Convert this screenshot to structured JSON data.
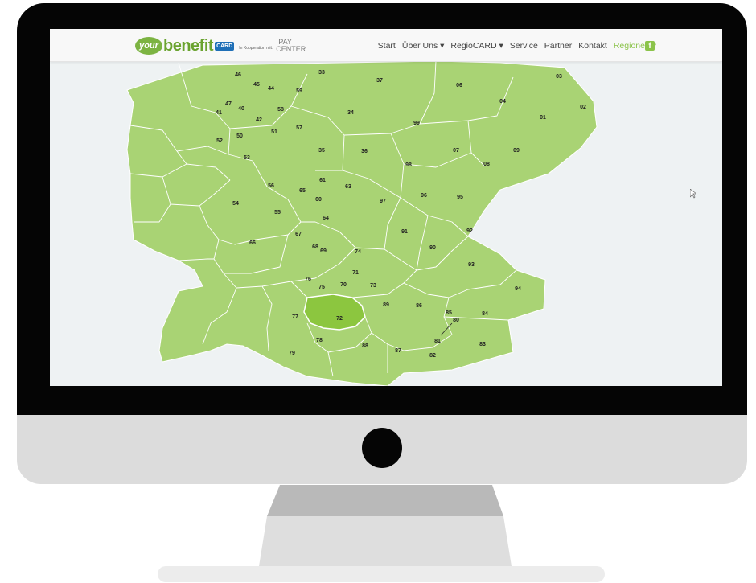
{
  "header": {
    "logo_badge": "your",
    "logo_word": "benefit",
    "logo_card": "CARD",
    "logo_koop": "In Kooperation mit:",
    "logo_pay": "PAY",
    "logo_center": "CENTER"
  },
  "nav": {
    "items": [
      {
        "label": "Start"
      },
      {
        "label": "Über Uns ▾"
      },
      {
        "label": "RegioCARD ▾"
      },
      {
        "label": "Service"
      },
      {
        "label": "Partner"
      },
      {
        "label": "Kontakt"
      },
      {
        "label": "Regionen ▾"
      }
    ],
    "facebook": "f"
  },
  "map": {
    "fill_color": "#a9d374",
    "highlight_color": "#8cc63f",
    "highlighted_region": "72",
    "regions": [
      "46",
      "45",
      "44",
      "33",
      "37",
      "06",
      "03",
      "47",
      "40",
      "41",
      "59",
      "58",
      "42",
      "34",
      "04",
      "02",
      "01",
      "51",
      "57",
      "99",
      "50",
      "52",
      "35",
      "36",
      "07",
      "09",
      "53",
      "98",
      "08",
      "56",
      "61",
      "63",
      "65",
      "60",
      "97",
      "96",
      "95",
      "54",
      "55",
      "64",
      "66",
      "67",
      "91",
      "68",
      "69",
      "74",
      "90",
      "92",
      "93",
      "71",
      "76",
      "75",
      "70",
      "73",
      "94",
      "89",
      "86",
      "85",
      "80",
      "84",
      "77",
      "72",
      "81",
      "78",
      "88",
      "87",
      "82",
      "79",
      "83"
    ]
  },
  "colors": {
    "accent": "#8bc34a",
    "bezel": "#050505",
    "chin": "#dcdcdc"
  }
}
